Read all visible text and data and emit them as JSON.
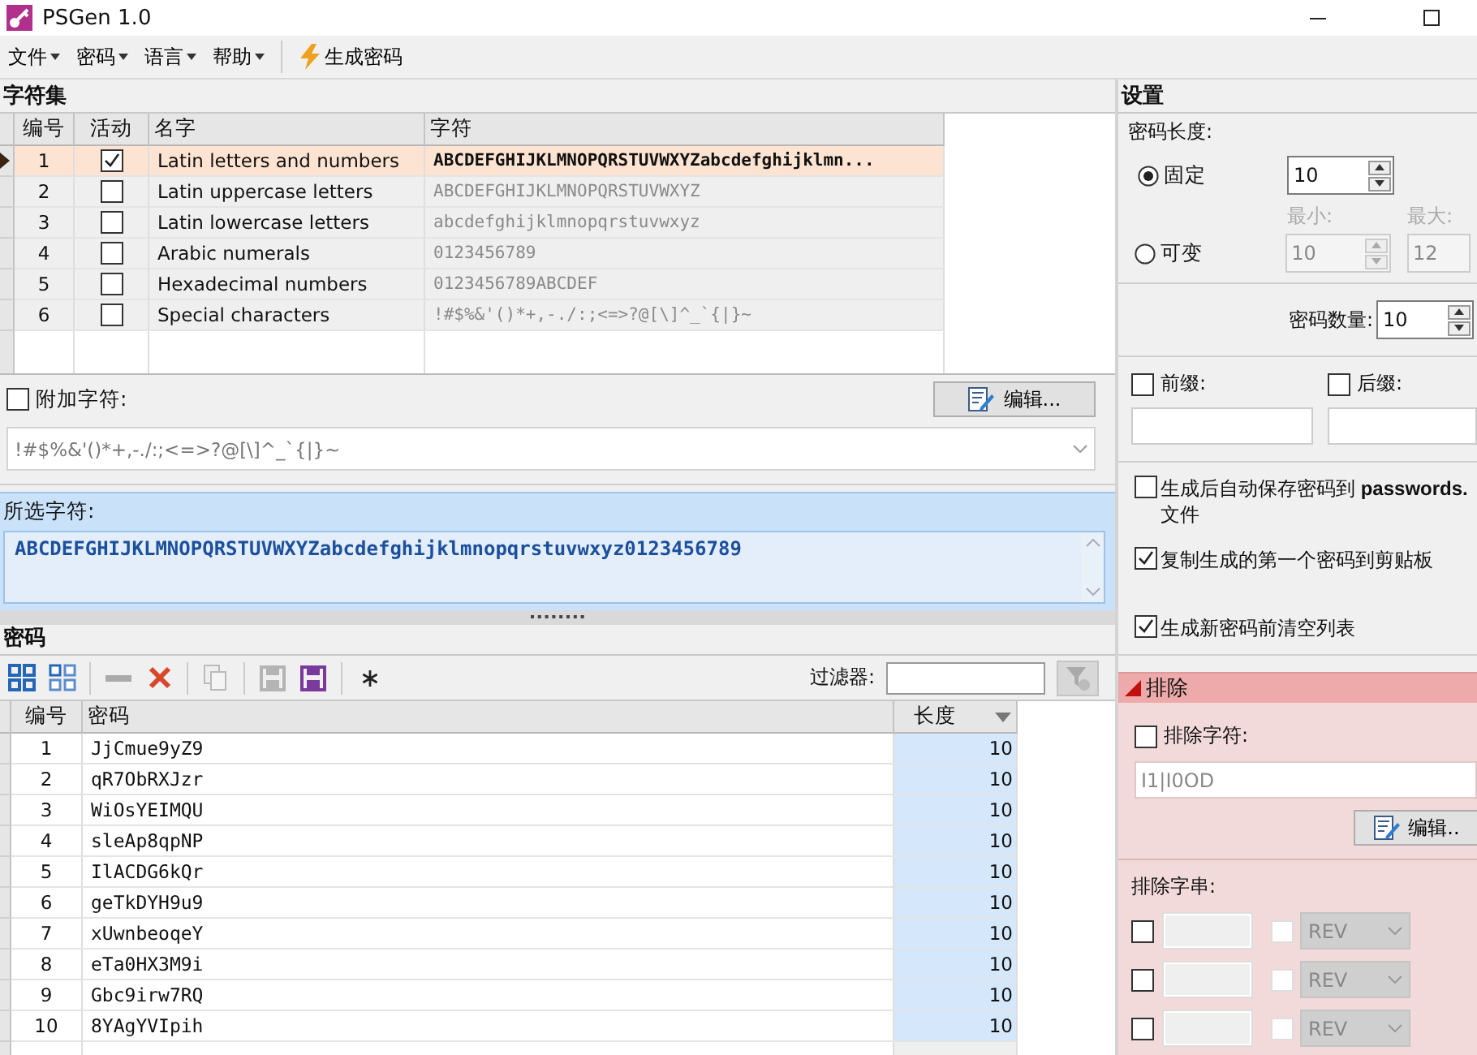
{
  "window": {
    "title": "PSGen 1.0"
  },
  "menu": [
    {
      "label": "文件"
    },
    {
      "label": "密码"
    },
    {
      "label": "语言"
    },
    {
      "label": "帮助"
    }
  ],
  "generate_button": "生成密码",
  "charsets": {
    "title": "字符集",
    "columns": [
      "编号",
      "活动",
      "名字",
      "字符"
    ],
    "rows": [
      {
        "number": "1",
        "active": true,
        "selected": true,
        "name": "Latin letters and numbers",
        "chars": "ABCDEFGHIJKLMNOPQRSTUVWXYZabcdefghijklmn..."
      },
      {
        "number": "2",
        "active": false,
        "selected": false,
        "name": "Latin uppercase letters",
        "chars": "ABCDEFGHIJKLMNOPQRSTUVWXYZ"
      },
      {
        "number": "3",
        "active": false,
        "selected": false,
        "name": "Latin lowercase letters",
        "chars": "abcdefghijklmnopqrstuvwxyz"
      },
      {
        "number": "4",
        "active": false,
        "selected": false,
        "name": "Arabic numerals",
        "chars": "0123456789"
      },
      {
        "number": "5",
        "active": false,
        "selected": false,
        "name": "Hexadecimal numbers",
        "chars": "0123456789ABCDEF"
      },
      {
        "number": "6",
        "active": false,
        "selected": false,
        "name": "Special characters",
        "chars": "!#$%&'()*+,-./:;<=>?@[\\]^_`{|}~"
      }
    ]
  },
  "extra_chars": {
    "label": "附加字符:",
    "checked": false,
    "edit_button": "编辑...",
    "value": "!#$%&'()*+,-./:;<=>?@[\\]^_`{|}~"
  },
  "selected_chars": {
    "label": "所选字符:",
    "value": "ABCDEFGHIJKLMNOPQRSTUVWXYZabcdefghijklmnopqrstuvwxyz0123456789"
  },
  "passwords": {
    "title": "密码",
    "filter_label": "过滤器:",
    "columns": [
      "编号",
      "密码",
      "长度"
    ],
    "rows": [
      {
        "number": "1",
        "password": "JjCmue9yZ9",
        "length": "10"
      },
      {
        "number": "2",
        "password": "qR7ObRXJzr",
        "length": "10"
      },
      {
        "number": "3",
        "password": "WiOsYEIMQU",
        "length": "10"
      },
      {
        "number": "4",
        "password": "sleAp8qpNP",
        "length": "10"
      },
      {
        "number": "5",
        "password": "IlACDG6kQr",
        "length": "10"
      },
      {
        "number": "6",
        "password": "geTkDYH9u9",
        "length": "10"
      },
      {
        "number": "7",
        "password": "xUwnbeoqeY",
        "length": "10"
      },
      {
        "number": "8",
        "password": "eTa0HX3M9i",
        "length": "10"
      },
      {
        "number": "9",
        "password": "Gbc9irw7RQ",
        "length": "10"
      },
      {
        "number": "10",
        "password": "8YAgYVIpih",
        "length": "10"
      }
    ]
  },
  "settings": {
    "title": "设置",
    "length_label": "密码长度:",
    "modes": [
      {
        "label": "固定",
        "selected": true
      },
      {
        "label": "可变",
        "selected": false
      }
    ],
    "fixed_length": "10",
    "min_label": "最小:",
    "max_label": "最大:",
    "min_length": "10",
    "max_length": "12",
    "count_label": "密码数量:",
    "count": "10",
    "prefix": {
      "label": "前缀:",
      "checked": false
    },
    "suffix": {
      "label": "后缀:",
      "checked": false
    },
    "options": [
      {
        "label": "生成后自动保存密码到 **passwords.** 文件",
        "checked": false
      },
      {
        "label": "复制生成的第一个密码到剪贴板",
        "checked": true
      },
      {
        "label": "生成新密码前清空列表",
        "checked": true
      }
    ]
  },
  "exclude": {
    "title": "排除",
    "chars": {
      "label": "排除字符:",
      "checked": false,
      "value": "I1|I0OD",
      "edit_button": "编辑.."
    },
    "strings_label": "排除字串:",
    "strings": [
      {
        "checked": false,
        "reverse_checked": false,
        "mode": "REV"
      },
      {
        "checked": false,
        "reverse_checked": false,
        "mode": "REV"
      },
      {
        "checked": false,
        "reverse_checked": false,
        "mode": "REV"
      }
    ]
  }
}
